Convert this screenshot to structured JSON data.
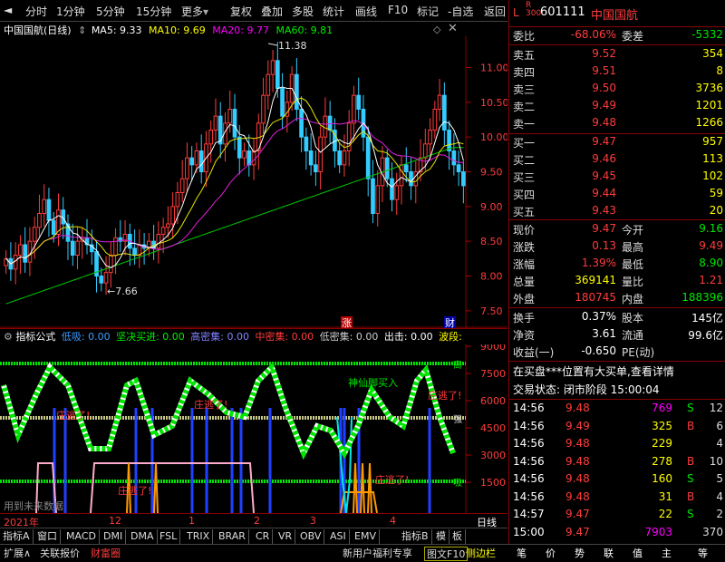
{
  "toolbar": {
    "items": [
      "分时",
      "1分钟",
      "5分钟",
      "15分钟",
      "更多",
      "复权",
      "叠加",
      "多股",
      "统计",
      "画线",
      "F10",
      "标记",
      "-自选",
      "返回"
    ]
  },
  "chart": {
    "title": "中国国航(日线)",
    "ma": [
      {
        "label": "MA5: 9.33",
        "color": "#ffffff"
      },
      {
        "label": "MA10: 9.69",
        "color": "#ffff00"
      },
      {
        "label": "MA20: 9.77",
        "color": "#ff00ff"
      },
      {
        "label": "MA60: 9.81",
        "color": "#00e600"
      }
    ],
    "price_axis": [
      "11.00",
      "10.50",
      "10.00",
      "9.50",
      "9.00",
      "8.50",
      "8.00",
      "7.50"
    ],
    "high_label": "11.38",
    "low_label": "7.66",
    "tag_zhang": "涨",
    "tag_cai": "财"
  },
  "indicator": {
    "name": "指标公式",
    "values": [
      {
        "t": "低吸: 0.00",
        "c": "#3c9cff"
      },
      {
        "t": "坚决买进: 0.00",
        "c": "#00e600"
      },
      {
        "t": "高密集: 0.00",
        "c": "#8080ff"
      },
      {
        "t": "中密集: 0.00",
        "c": "#ff3c3c"
      },
      {
        "t": "低密集: 0.00",
        "c": "#ccc"
      },
      {
        "t": "出击: 0.00",
        "c": "#fff"
      },
      {
        "t": "波段:",
        "c": "#ffff00"
      }
    ],
    "axis": [
      "9000",
      "7500",
      "6000",
      "4500",
      "3000",
      "1500"
    ],
    "labels": [
      "庄逃了!",
      "庄逃了!",
      "神仙脚买入",
      "庄逃了!",
      "庄逃了!",
      "庄逃了!"
    ],
    "right_marks": [
      "高",
      "强",
      "吸"
    ],
    "footnote": "用到未来数据"
  },
  "xaxis": {
    "labels": [
      "2021年",
      "12",
      "1",
      "2",
      "3",
      "4"
    ],
    "period": "日线"
  },
  "tabs": [
    "指标A",
    "窗口",
    "MACD",
    "DMI",
    "DMA",
    "FSL",
    "TRIX",
    "BRAR",
    "CR",
    "VR",
    "OBV",
    "ASI",
    "EMV",
    "指标B",
    "模",
    "板"
  ],
  "status": {
    "items": [
      "扩展∧",
      "关联报价",
      "财富圈",
      "新用户福利专享",
      "图文F10",
      "侧边栏"
    ],
    "icons": [
      "笔",
      "价",
      "势",
      "联",
      "值",
      "主",
      "等"
    ]
  },
  "quote": {
    "code": "601111",
    "name": "中国国航",
    "flags": "L  R\n300",
    "webi": "-68.06%",
    "weicha": "-5332",
    "sells": [
      {
        "l": "卖五",
        "p": "9.52",
        "v": "354"
      },
      {
        "l": "卖四",
        "p": "9.51",
        "v": "8"
      },
      {
        "l": "卖三",
        "p": "9.50",
        "v": "3736"
      },
      {
        "l": "卖二",
        "p": "9.49",
        "v": "1201"
      },
      {
        "l": "卖一",
        "p": "9.48",
        "v": "1266"
      }
    ],
    "buys": [
      {
        "l": "买一",
        "p": "9.47",
        "v": "957"
      },
      {
        "l": "买二",
        "p": "9.46",
        "v": "113"
      },
      {
        "l": "买三",
        "p": "9.45",
        "v": "102"
      },
      {
        "l": "买四",
        "p": "9.44",
        "v": "59"
      },
      {
        "l": "买五",
        "p": "9.43",
        "v": "20"
      }
    ],
    "stats": [
      [
        {
          "k": "现价",
          "v": "9.47",
          "c": "red"
        },
        {
          "k": "今开",
          "v": "9.16",
          "c": "green"
        }
      ],
      [
        {
          "k": "涨跌",
          "v": "0.13",
          "c": "red"
        },
        {
          "k": "最高",
          "v": "9.49",
          "c": "red"
        }
      ],
      [
        {
          "k": "涨幅",
          "v": "1.39%",
          "c": "red"
        },
        {
          "k": "最低",
          "v": "8.90",
          "c": "green"
        }
      ],
      [
        {
          "k": "总量",
          "v": "369141",
          "c": "yellow"
        },
        {
          "k": "量比",
          "v": "1.21",
          "c": "red"
        }
      ],
      [
        {
          "k": "外盘",
          "v": "180745",
          "c": "red"
        },
        {
          "k": "内盘",
          "v": "188396",
          "c": "green"
        }
      ]
    ],
    "stats2": [
      [
        {
          "k": "换手",
          "v": "0.37%",
          "c": "white"
        },
        {
          "k": "股本",
          "v": "145亿",
          "c": "white"
        }
      ],
      [
        {
          "k": "净资",
          "v": "3.61",
          "c": "white"
        },
        {
          "k": "流通",
          "v": "99.6亿",
          "c": "white"
        }
      ],
      [
        {
          "k": "收益(一)",
          "v": "-0.650",
          "c": "white"
        },
        {
          "k": "PE(动)",
          "v": "",
          "c": "white"
        }
      ]
    ],
    "notice": "在买盘***位置有大买单,查看详情",
    "trade_state": "交易状态: 闭市阶段 15:00:04",
    "ticks": [
      {
        "t": "14:56",
        "p": "9.48",
        "v": "769",
        "s": "S",
        "n": "12",
        "vc": "magenta"
      },
      {
        "t": "14:56",
        "p": "9.49",
        "v": "325",
        "s": "B",
        "n": "6",
        "vc": "yellow"
      },
      {
        "t": "14:56",
        "p": "9.48",
        "v": "229",
        "s": "",
        "n": "4",
        "vc": "yellow"
      },
      {
        "t": "14:56",
        "p": "9.48",
        "v": "278",
        "s": "B",
        "n": "10",
        "vc": "yellow"
      },
      {
        "t": "14:56",
        "p": "9.48",
        "v": "160",
        "s": "S",
        "n": "5",
        "vc": "yellow"
      },
      {
        "t": "14:56",
        "p": "9.48",
        "v": "31",
        "s": "B",
        "n": "4",
        "vc": "yellow"
      },
      {
        "t": "14:57",
        "p": "9.47",
        "v": "22",
        "s": "S",
        "n": "2",
        "vc": "yellow"
      },
      {
        "t": "15:00",
        "p": "9.47",
        "v": "7903",
        "s": "",
        "n": "370",
        "vc": "magenta"
      }
    ]
  }
}
